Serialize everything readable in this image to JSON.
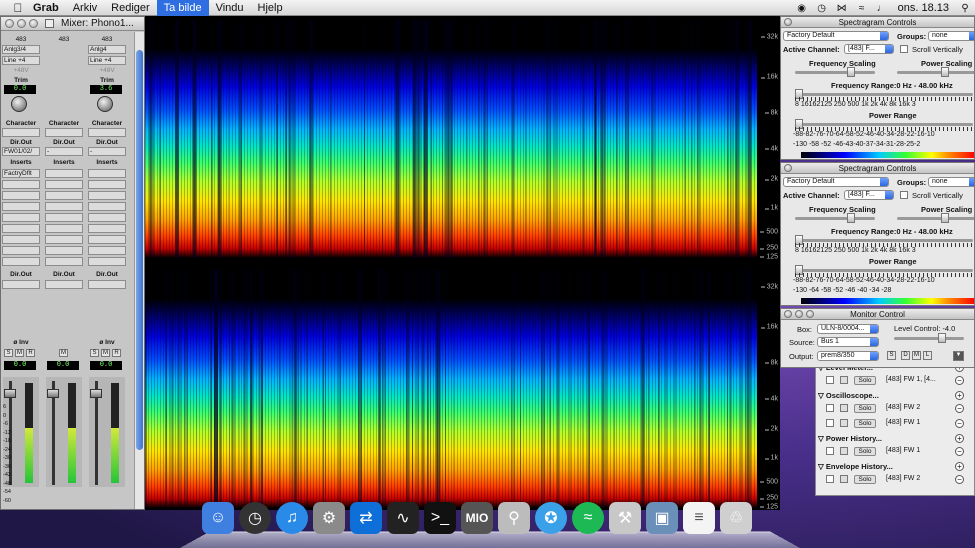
{
  "menubar": {
    "app": "Grab",
    "menus": [
      "Arkiv",
      "Rediger",
      "Ta bilde",
      "Vindu",
      "Hjelp"
    ],
    "active_menu": "Ta bilde",
    "clock": "ons. 18.13"
  },
  "mixer": {
    "title": "Mixer: Phono1...",
    "channels": [
      {
        "id": "483",
        "input": "Anlg3/4",
        "level": "Line +4",
        "phantom": "+48V",
        "trim_label": "Trim",
        "trim_value": "0.0",
        "character": "Character",
        "dir_out": "Dir.Out",
        "output": "FW01/02/",
        "inserts": "Inserts",
        "insert_1": "FactryDflt",
        "dir_out_2": "Dir.Out",
        "inv": "ø Inv",
        "fader_value": "0.0"
      },
      {
        "id": "483",
        "input": "",
        "level": "",
        "phantom": "",
        "trim_label": "",
        "trim_value": "",
        "character": "Character",
        "dir_out": "Dir.Out",
        "output": "-",
        "inserts": "Inserts",
        "insert_1": "",
        "dir_out_2": "Dir.Out",
        "inv": "",
        "fader_value": "0.0"
      },
      {
        "id": "483",
        "input": "Anlg4",
        "level": "Line +4",
        "phantom": "+48V",
        "trim_label": "Trim",
        "trim_value": "3.6",
        "character": "Character",
        "dir_out": "Dir.Out",
        "output": "-",
        "inserts": "Inserts",
        "insert_1": "",
        "dir_out_2": "Dir.Out",
        "inv": "ø Inv",
        "fader_value": "0.0"
      }
    ],
    "smr": [
      "S",
      "M",
      "R"
    ],
    "scale": [
      "6",
      "0",
      "-6",
      "-12",
      "-18",
      "-24",
      "-30",
      "-36",
      "-42",
      "-48",
      "-54",
      "-60"
    ]
  },
  "spectrogram": {
    "freq_labels": [
      "32k",
      "16k",
      "8k",
      "4k",
      "2k",
      "1k",
      "500",
      "250",
      "125"
    ]
  },
  "spectrogram_controls": [
    {
      "title": "Spectragram Controls",
      "preset": "Factory Default",
      "groups_label": "Groups:",
      "groups_value": "none",
      "active_channel_label": "Active Channel:",
      "active_channel": "[483] F...",
      "scroll_vertically": "Scroll Vertically",
      "frequency_scaling": "Frequency Scaling",
      "power_scaling": "Power Scaling",
      "frequency_range": "Frequency Range:0 Hz - 48.00 kHz",
      "freq_ticks": "8 16162125 250 500  1k   2k   4k   8k  16k  3",
      "power_range": "Power Range",
      "power_ticks": "-88-82-76-70-64-58-52-46-40-34-28-22-16-10",
      "power_values": "-130   -58    -52    -46-43-40-37-34-31-28-25-2"
    },
    {
      "title": "Spectragram Controls",
      "preset": "Factory Default",
      "groups_label": "Groups:",
      "groups_value": "none",
      "active_channel_label": "Active Channel:",
      "active_channel": "[483] F...",
      "scroll_vertically": "Scroll Vertically",
      "frequency_scaling": "Frequency Scaling",
      "power_scaling": "Power Scaling",
      "frequency_range": "Frequency Range:0 Hz - 48.00 kHz",
      "freq_ticks": "8 16162125 250 500  1k   2k   4k   8k  16k  3",
      "power_range": "Power Range",
      "power_ticks": "-88-82-76-70-64-58-52-46-40-34-28-22-16-10",
      "power_values": "-130   -64    -58   -52    -46    -40    -34    -28"
    }
  ],
  "monitor_control": {
    "title": "Monitor Control",
    "box_label": "Box:",
    "box_value": "ULN-8/0004...",
    "level_control": "Level Control: -4.0",
    "source_label": "Source:",
    "source_value": "Bus 1",
    "output_label": "Output:",
    "output_value": "prem8/350",
    "buttons": [
      "S",
      "D",
      "M",
      "L"
    ]
  },
  "monitor_list": {
    "groups": [
      {
        "name": "Level Meter...",
        "items": [
          "[483] FW 1, [4..."
        ]
      },
      {
        "name": "Oscilloscope...",
        "items": [
          "[483] FW 2",
          "[483] FW 1"
        ]
      },
      {
        "name": "Power History...",
        "items": [
          "[483] FW 1"
        ]
      },
      {
        "name": "Envelope History...",
        "items": [
          "[483] FW 2"
        ]
      }
    ],
    "solo_label": "Solo"
  },
  "dock": {
    "items": [
      "finder-icon",
      "dashboard-icon",
      "itunes-icon",
      "system-preferences-icon",
      "teamviewer-icon",
      "activity-monitor-icon",
      "terminal-icon",
      "mio-icon",
      "magnifier-icon",
      "safari-icon",
      "spotify-icon",
      "utility-icon",
      "preview-icon",
      "document-icon",
      "trash-icon"
    ],
    "mio_label": "MIO"
  }
}
